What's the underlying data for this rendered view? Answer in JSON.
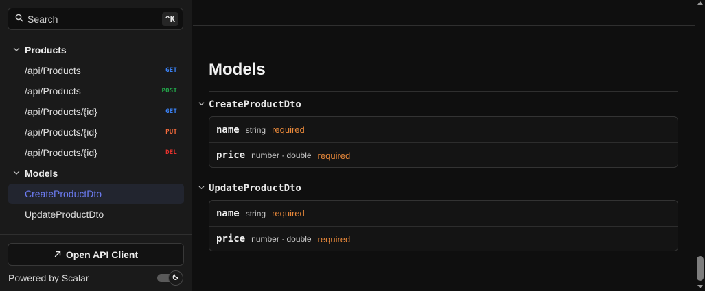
{
  "search": {
    "label": "Search",
    "shortcut": "^K"
  },
  "nav": {
    "products_group": "Products",
    "endpoints": [
      {
        "path": "/api/Products",
        "method": "GET",
        "color": "#3b82f6"
      },
      {
        "path": "/api/Products",
        "method": "POST",
        "color": "#22a84a"
      },
      {
        "path": "/api/Products/{id}",
        "method": "GET",
        "color": "#3b82f6"
      },
      {
        "path": "/api/Products/{id}",
        "method": "PUT",
        "color": "#f56a3b"
      },
      {
        "path": "/api/Products/{id}",
        "method": "DEL",
        "color": "#e5322d"
      }
    ],
    "models_group": "Models",
    "models": [
      "CreateProductDto",
      "UpdateProductDto"
    ]
  },
  "footer": {
    "open_client": "Open API Client",
    "powered_by": "Powered by Scalar"
  },
  "main": {
    "title": "Models",
    "models": [
      {
        "name": "CreateProductDto",
        "props": [
          {
            "name": "name",
            "type": "string",
            "required": "required"
          },
          {
            "name": "price",
            "type": "number · double",
            "required": "required"
          }
        ]
      },
      {
        "name": "UpdateProductDto",
        "props": [
          {
            "name": "name",
            "type": "string",
            "required": "required"
          },
          {
            "name": "price",
            "type": "number · double",
            "required": "required"
          }
        ]
      }
    ]
  }
}
